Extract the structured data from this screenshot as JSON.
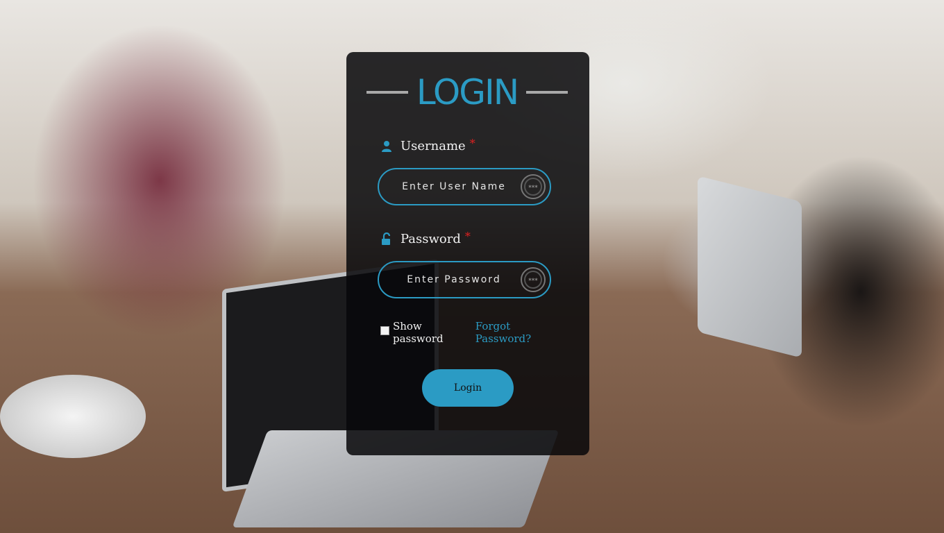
{
  "login": {
    "title": "LOGIN",
    "username": {
      "label": "Username",
      "required_mark": "*",
      "placeholder": "Enter User Name",
      "value": "",
      "icon": "user-icon"
    },
    "password": {
      "label": "Password",
      "required_mark": "*",
      "placeholder": "Enter Password",
      "value": "",
      "icon": "unlock-icon"
    },
    "show_password": {
      "label": "Show password",
      "checked": false
    },
    "forgot_password": "Forgot Password?",
    "button": "Login"
  },
  "colors": {
    "accent": "#2b9bc4",
    "required": "#e02020",
    "card_bg": "rgba(8,8,10,0.86)"
  }
}
